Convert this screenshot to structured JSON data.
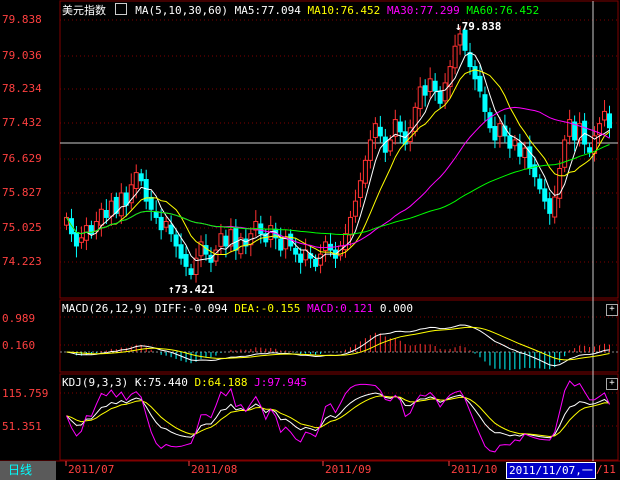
{
  "main": {
    "title": "美元指数",
    "ma_icon": "ma-toggle-icon",
    "ma_label": "MA(5,10,30,60)",
    "ma5": "MA5:77.094",
    "ma10": "MA10:76.452",
    "ma30": "MA30:77.299",
    "ma60": "MA60:76.452",
    "high_label": "79.838",
    "low_label": "73.421",
    "yticks": [
      "79.838",
      "79.036",
      "78.234",
      "77.432",
      "76.629",
      "75.827",
      "75.025",
      "74.223"
    ]
  },
  "macd": {
    "label": "MACD(26,12,9)",
    "diff": "DIFF:-0.094",
    "dea": "DEA:-0.155",
    "macd": "MACD:0.121",
    "extra": "0.000",
    "yticks": [
      "0.989",
      "0.160"
    ]
  },
  "kdj": {
    "label": "KDJ(9,3,3)",
    "k": "K:75.440",
    "d": "D:64.188",
    "j": "J:97.945",
    "yticks": [
      "115.759",
      "51.351"
    ]
  },
  "xaxis": {
    "labels": [
      "2011/07",
      "2011/08",
      "2011/09",
      "2011/10"
    ]
  },
  "footer": {
    "period": "日线",
    "cursor_date": "2011/11/07,一",
    "tail": "/11"
  },
  "colors": {
    "up": "#ff3232",
    "down": "#00ffff",
    "ma5": "#ffffff",
    "ma10": "#ffff00",
    "ma30": "#ff00ff",
    "ma60": "#00ff00",
    "grid": "#800000"
  },
  "chart_data": {
    "type": "candlestick",
    "y_range": [
      73.421,
      79.838
    ],
    "high": 79.838,
    "low": 73.421,
    "closes": [
      75.0,
      74.6,
      74.3,
      74.5,
      74.8,
      74.6,
      74.9,
      75.2,
      75.0,
      75.4,
      75.1,
      75.6,
      75.3,
      75.8,
      76.1,
      75.9,
      75.4,
      75.2,
      75.0,
      74.7,
      74.9,
      74.6,
      74.3,
      74.0,
      73.8,
      73.6,
      74.0,
      74.4,
      74.1,
      73.9,
      74.2,
      74.6,
      74.3,
      74.7,
      74.2,
      74.5,
      74.3,
      74.6,
      74.9,
      74.6,
      74.4,
      74.8,
      74.5,
      74.2,
      74.5,
      74.3,
      74.1,
      73.9,
      74.2,
      74.0,
      73.8,
      74.1,
      74.4,
      74.2,
      74.0,
      74.3,
      74.6,
      75.0,
      75.4,
      75.9,
      76.4,
      76.9,
      77.3,
      77.0,
      76.6,
      76.9,
      77.4,
      77.1,
      76.8,
      77.2,
      77.7,
      78.2,
      78.0,
      78.4,
      78.1,
      77.8,
      78.3,
      78.7,
      79.2,
      79.5,
      79.1,
      78.7,
      78.4,
      78.1,
      77.6,
      77.2,
      76.9,
      77.3,
      77.0,
      76.7,
      76.9,
      76.5,
      76.7,
      76.2,
      76.0,
      75.7,
      75.4,
      75.1,
      75.5,
      76.2,
      76.9,
      77.4,
      76.9,
      77.3,
      76.8,
      76.6,
      77.0,
      77.3,
      77.6,
      77.2
    ]
  }
}
